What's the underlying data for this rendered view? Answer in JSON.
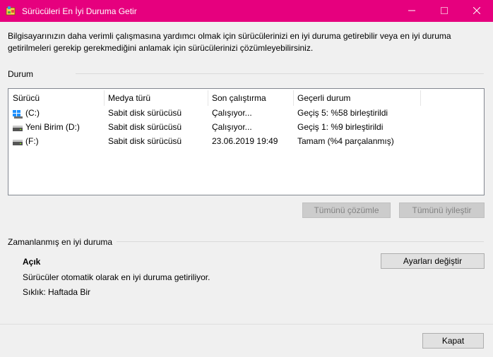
{
  "window": {
    "title": "Sürücüleri En İyi Duruma Getir",
    "title_bar_color": "#e6007e"
  },
  "intro_text": "Bilgisayarınızın daha verimli çalışmasına yardımcı olmak için sürücülerinizi en iyi duruma getirebilir veya en iyi duruma getirilmeleri gerekip gerekmediğini anlamak için sürücülerinizi çözümleyebilirsiniz.",
  "status": {
    "label": "Durum",
    "columns": [
      "Sürücü",
      "Medya türü",
      "Son çalıştırma",
      "Geçerli durum"
    ],
    "rows": [
      {
        "drive": "(C:)",
        "icon": "windows-drive-icon",
        "media": "Sabit disk sürücüsü",
        "last_run": "Çalışıyor...",
        "status": "Geçiş 5: %58 birleştirildi"
      },
      {
        "drive": "Yeni Birim (D:)",
        "icon": "hard-drive-icon",
        "media": "Sabit disk sürücüsü",
        "last_run": "Çalışıyor...",
        "status": "Geçiş 1: %9 birleştirildi"
      },
      {
        "drive": "(F:)",
        "icon": "hard-drive-icon",
        "media": "Sabit disk sürücüsü",
        "last_run": "23.06.2019 19:49",
        "status": "Tamam (%4 parçalanmış)"
      }
    ],
    "analyze_all_label": "Tümünü çözümle",
    "optimize_all_label": "Tümünü iyileştir"
  },
  "scheduled": {
    "label": "Zamanlanmış en iyi duruma",
    "state": "Açık",
    "description": "Sürücüler otomatik olarak en iyi duruma getiriliyor.",
    "frequency": "Sıklık: Haftada Bir",
    "change_settings_label": "Ayarları değiştir"
  },
  "close_label": "Kapat"
}
